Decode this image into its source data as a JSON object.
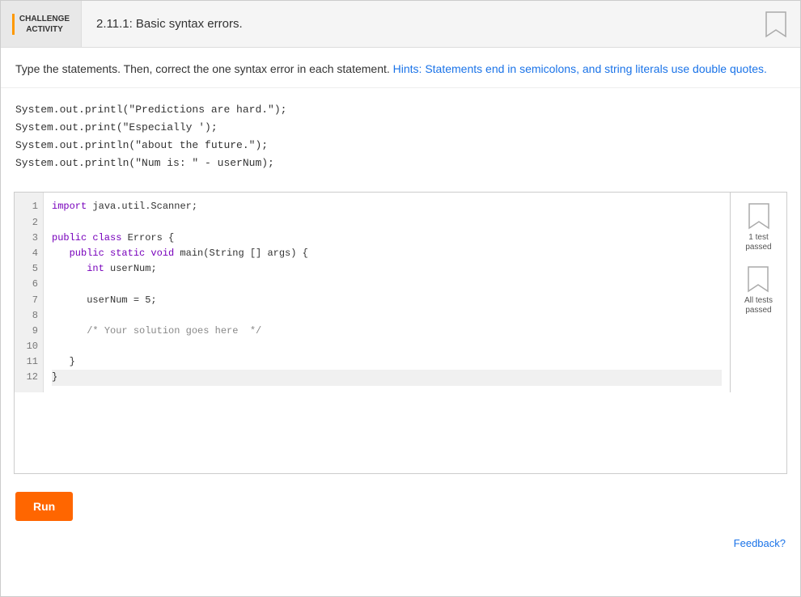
{
  "header": {
    "badge_line1": "CHALLENGE",
    "badge_line2": "ACTIVITY",
    "title": "2.11.1: Basic syntax errors.",
    "bookmark_label": "bookmark"
  },
  "instructions": {
    "text": "Type the statements. Then, correct the one syntax error in each statement. Hints: Statements end in semicolons, and string literals use double quotes."
  },
  "code_display": {
    "lines": [
      "System.out.printl(\"Predictions are hard.\");",
      "System.out.print(\"Especially ');",
      "System.out.println(\"about the future.\");",
      "System.out.println(\"Num is: \" - userNum);"
    ]
  },
  "editor": {
    "lines": [
      {
        "num": "1",
        "text": "import java.util.Scanner;",
        "highlighted": false
      },
      {
        "num": "2",
        "text": "",
        "highlighted": false
      },
      {
        "num": "3",
        "text": "public class Errors {",
        "highlighted": false
      },
      {
        "num": "4",
        "text": "   public static void main(String [] args) {",
        "highlighted": false
      },
      {
        "num": "5",
        "text": "      int userNum;",
        "highlighted": false
      },
      {
        "num": "6",
        "text": "",
        "highlighted": false
      },
      {
        "num": "7",
        "text": "      userNum = 5;",
        "highlighted": false
      },
      {
        "num": "8",
        "text": "",
        "highlighted": false
      },
      {
        "num": "9",
        "text": "      /* Your solution goes here  */",
        "highlighted": false
      },
      {
        "num": "10",
        "text": "",
        "highlighted": false
      },
      {
        "num": "11",
        "text": "   }",
        "highlighted": false
      },
      {
        "num": "12",
        "text": "}",
        "highlighted": true
      }
    ]
  },
  "test_results": [
    {
      "label": "1 test\npassed"
    },
    {
      "label": "All tests\npassed"
    }
  ],
  "run_button": {
    "label": "Run"
  },
  "feedback": {
    "label": "Feedback?"
  }
}
